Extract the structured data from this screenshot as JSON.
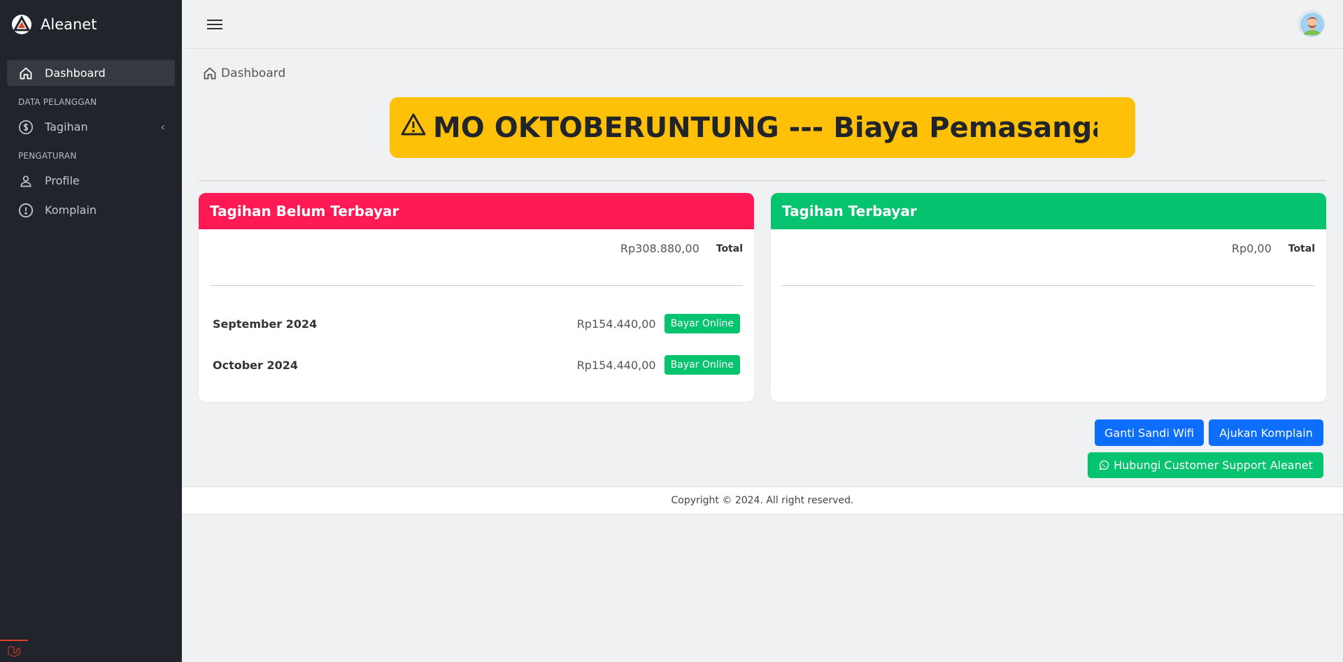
{
  "app": {
    "name": "Aleanet"
  },
  "sidebar": {
    "items": [
      {
        "label": "Dashboard",
        "icon": "home-icon",
        "active": true
      },
      {
        "header": "DATA PELANGGAN"
      },
      {
        "label": "Tagihan",
        "icon": "dollar-circle-icon",
        "expandable": true
      },
      {
        "header": "PENGATURAN"
      },
      {
        "label": "Profile",
        "icon": "user-icon"
      },
      {
        "label": "Komplain",
        "icon": "alert-circle-icon"
      }
    ]
  },
  "breadcrumb": {
    "label": "Dashboard"
  },
  "banner": {
    "text": "MO OKTOBERUNTUNG --- Biaya Pemasangan Aw",
    "color": "#ffc107"
  },
  "unpaid": {
    "title": "Tagihan Belum Terbayar",
    "total_amount": "Rp308.880,00",
    "total_label": "Total",
    "bills": [
      {
        "month": "September 2024",
        "amount": "Rp154.440,00",
        "action": "Bayar Online"
      },
      {
        "month": "October 2024",
        "amount": "Rp154.440,00",
        "action": "Bayar Online"
      }
    ],
    "color": "#ff1a56"
  },
  "paid": {
    "title": "Tagihan Terbayar",
    "total_amount": "Rp0,00",
    "total_label": "Total",
    "color": "#05c36e"
  },
  "actions": {
    "change_wifi": "Ganti Sandi Wifi",
    "complaint": "Ajukan Komplain",
    "support": "Hubungi Customer Support Aleanet"
  },
  "footer": {
    "text": "Copyright © 2024. All right reserved."
  }
}
